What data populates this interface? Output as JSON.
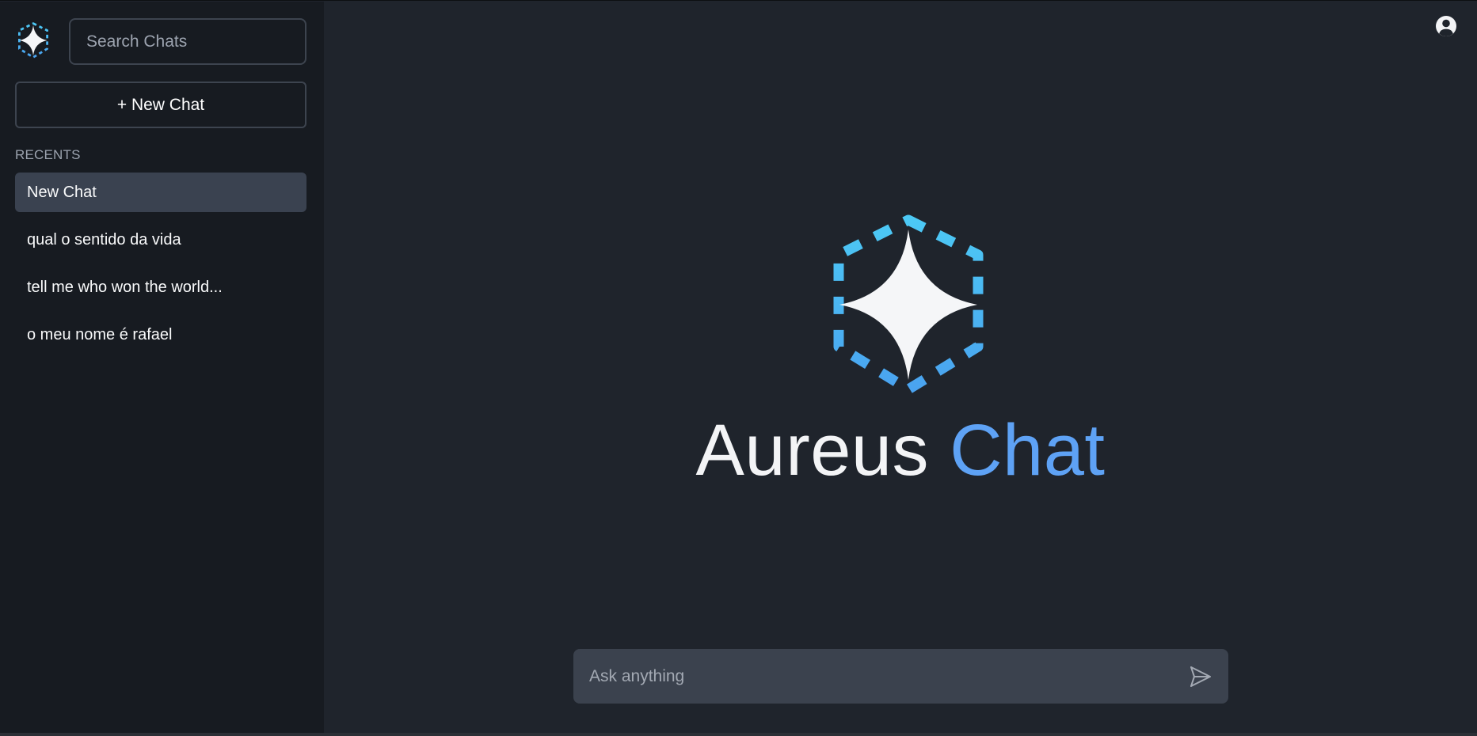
{
  "sidebar": {
    "search_placeholder": "Search Chats",
    "new_chat_label": "+ New Chat",
    "recents_label": "RECENTS",
    "chats": [
      {
        "title": "New Chat",
        "active": true
      },
      {
        "title": "qual o sentido da vida",
        "active": false
      },
      {
        "title": "tell me who won the world...",
        "active": false
      },
      {
        "title": "o meu nome é rafael",
        "active": false
      }
    ]
  },
  "main": {
    "brand_primary": "Aureus",
    "brand_accent": "Chat",
    "composer_placeholder": "Ask anything"
  },
  "icons": {
    "logo": "aureus-star-logo-icon",
    "user": "user-circle-icon",
    "send": "send-icon"
  },
  "colors": {
    "accent": "#5ea2f5",
    "logo_gradient_top": "#4cc9f5",
    "logo_gradient_bottom": "#4aa3f0",
    "active_item": "#3a4250"
  }
}
